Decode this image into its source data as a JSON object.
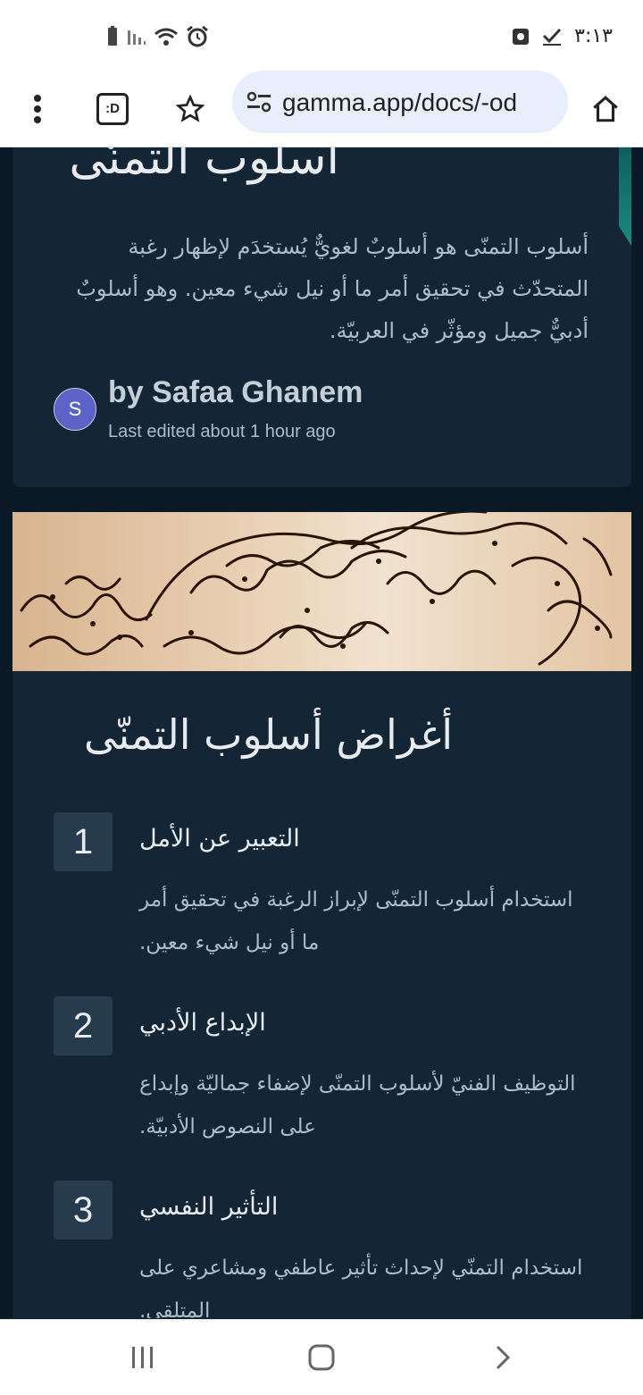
{
  "status_bar": {
    "time": "٣:١٣",
    "icons_left": [
      "battery-icon",
      "signal-icon",
      "wifi-icon",
      "alarm-icon"
    ],
    "icons_right": [
      "record-icon",
      "check-icon"
    ]
  },
  "browser": {
    "url": "gamma.app/docs/-od",
    "toolbar_icons": [
      "more-menu-icon",
      "tab-switcher-icon",
      "star-icon",
      "site-settings-icon",
      "home-icon"
    ],
    "tab_switcher_label": ":D"
  },
  "doc": {
    "title": "أسلوب التمنّى",
    "paragraph": "أسلوب التمنّى هو أسلوبٌ لغويٌّ يُستخدَم لإظهار رغبة المتحدّث في تحقيق أمر ما أو نيل شيء معين. وهو أسلوبٌ أدبيٌّ جميل ومؤثّر في العربيّة.",
    "author_initial": "S",
    "author": "by Safaa Ghanem",
    "edited": "Last edited about 1 hour ago"
  },
  "section": {
    "title": "أغراض أسلوب التمنّى",
    "items": [
      {
        "number": "1",
        "title": "التعبير عن الأمل",
        "desc": "استخدام أسلوب التمنّى لإبراز الرغبة في تحقيق أمر ما أو نيل شيء معين."
      },
      {
        "number": "2",
        "title": "الإبداع الأدبي",
        "desc": "التوظيف الفنيّ لأسلوب التمنّى لإضفاء جماليّة وإبداع على النصوص الأدبيّة."
      },
      {
        "number": "3",
        "title": "التأثير النفسي",
        "desc": "استخدام التمنّي لإحداث تأثير عاطفي ومشاعري على المتلقي."
      }
    ]
  },
  "nav_icons": [
    "recent-apps-icon",
    "home-nav-icon",
    "back-icon"
  ]
}
